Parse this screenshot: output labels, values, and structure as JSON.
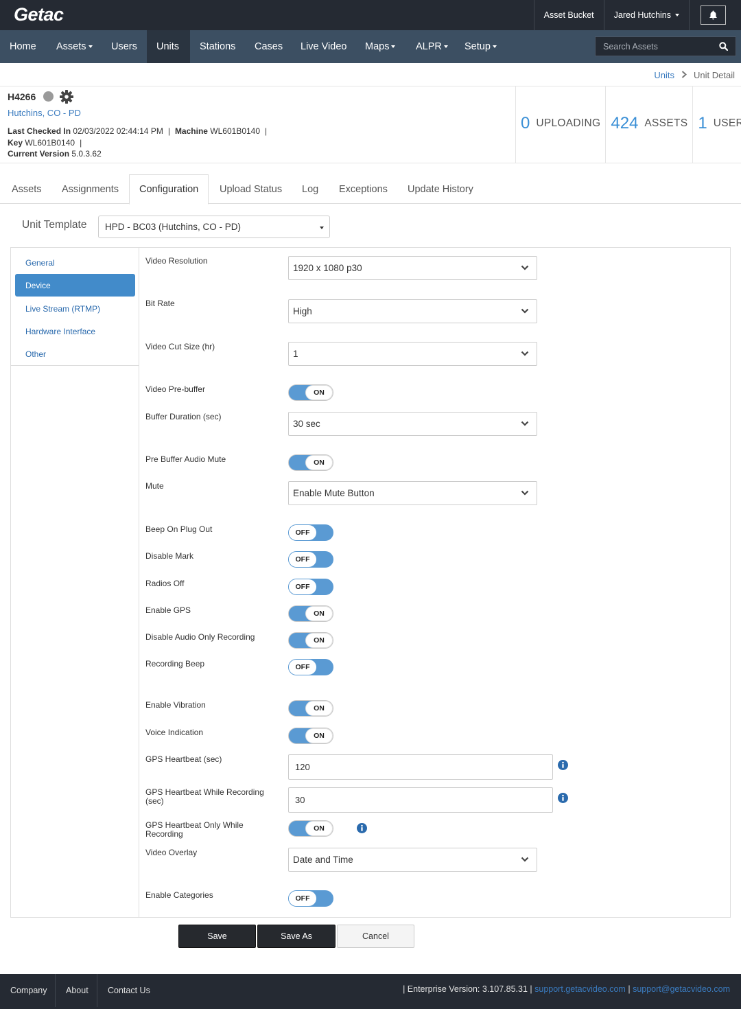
{
  "app": {
    "logo": "Getac"
  },
  "topbar": {
    "asset_bucket": "Asset Bucket",
    "user_name": "Jared Hutchins",
    "bell_icon": "bell-icon"
  },
  "nav": {
    "home": "Home",
    "assets": "Assets",
    "users": "Users",
    "units": "Units",
    "stations": "Stations",
    "cases": "Cases",
    "live_video": "Live Video",
    "maps": "Maps",
    "alpr": "ALPR",
    "setup": "Setup",
    "active": "Units",
    "search_placeholder": "Search Assets"
  },
  "breadcrumb": {
    "parent": "Units",
    "current": "Unit Detail"
  },
  "unit": {
    "id": "H4266",
    "location": "Hutchins, CO - PD",
    "last_checked_label": "Last Checked In",
    "last_checked": "02/03/2022 02:44:14 PM",
    "machine_label": "Machine",
    "machine": "WL601B0140",
    "key_label": "Key",
    "key": "WL601B0140",
    "version_label": "Current Version",
    "version": "5.0.3.62",
    "sep": "|"
  },
  "stats": [
    {
      "num": "0",
      "label": "UPLOADING"
    },
    {
      "num": "424",
      "label": "ASSETS"
    },
    {
      "num": "1",
      "label": "USERS"
    }
  ],
  "tabs": [
    "Assets",
    "Assignments",
    "Configuration",
    "Upload Status",
    "Log",
    "Exceptions",
    "Update History"
  ],
  "active_tab": "Configuration",
  "template": {
    "label": "Unit Template",
    "value": "HPD - BC03 (Hutchins, CO - PD)"
  },
  "sidebar": [
    "General",
    "Device",
    "Live Stream (RTMP)",
    "Hardware Interface",
    "Other"
  ],
  "sidebar_active": "Device",
  "fields": {
    "video_resolution": {
      "label": "Video Resolution",
      "value": "1920 x 1080 p30"
    },
    "bit_rate": {
      "label": "Bit Rate",
      "value": "High"
    },
    "video_cut_size": {
      "label": "Video Cut Size (hr)",
      "value": "1"
    },
    "video_prebuffer": {
      "label": "Video Pre-buffer",
      "state": "ON"
    },
    "buffer_duration": {
      "label": "Buffer Duration (sec)",
      "value": "30 sec"
    },
    "pre_buffer_audio_mute": {
      "label": "Pre Buffer Audio Mute",
      "state": "ON"
    },
    "mute": {
      "label": "Mute",
      "value": "Enable Mute Button"
    },
    "beep_on_plug_out": {
      "label": "Beep On Plug Out",
      "state": "OFF"
    },
    "disable_mark": {
      "label": "Disable Mark",
      "state": "OFF"
    },
    "radios_off": {
      "label": "Radios Off",
      "state": "OFF"
    },
    "enable_gps": {
      "label": "Enable GPS",
      "state": "ON"
    },
    "disable_audio_only": {
      "label": "Disable Audio Only Recording",
      "state": "ON"
    },
    "recording_beep": {
      "label": "Recording Beep",
      "state": "OFF"
    },
    "enable_vibration": {
      "label": "Enable Vibration",
      "state": "ON"
    },
    "voice_indication": {
      "label": "Voice Indication",
      "state": "ON"
    },
    "gps_heartbeat": {
      "label": "GPS Heartbeat (sec)",
      "value": "120"
    },
    "gps_heartbeat_recording": {
      "label": "GPS Heartbeat While Recording (sec)",
      "value": "30"
    },
    "gps_heartbeat_only_recording": {
      "label": "GPS Heartbeat Only While Recording",
      "state": "ON"
    },
    "video_overlay": {
      "label": "Video Overlay",
      "value": "Date and Time"
    },
    "enable_categories": {
      "label": "Enable Categories",
      "state": "OFF"
    }
  },
  "buttons": {
    "save": "Save",
    "save_as": "Save As",
    "cancel": "Cancel"
  },
  "footer": {
    "company": "Company",
    "about": "About",
    "contact": "Contact Us",
    "version_text": "| Enterprise Version: 3.107.85.31 |",
    "support_site": "support.getacvideo.com",
    "pipe": "|",
    "support_email": "support@getacvideo.com"
  },
  "colors": {
    "topbar": "#252a33",
    "navbar": "#3c4f62",
    "accent": "#428bca",
    "link": "#3a7bbf",
    "stat_number": "#3a8fd6"
  }
}
